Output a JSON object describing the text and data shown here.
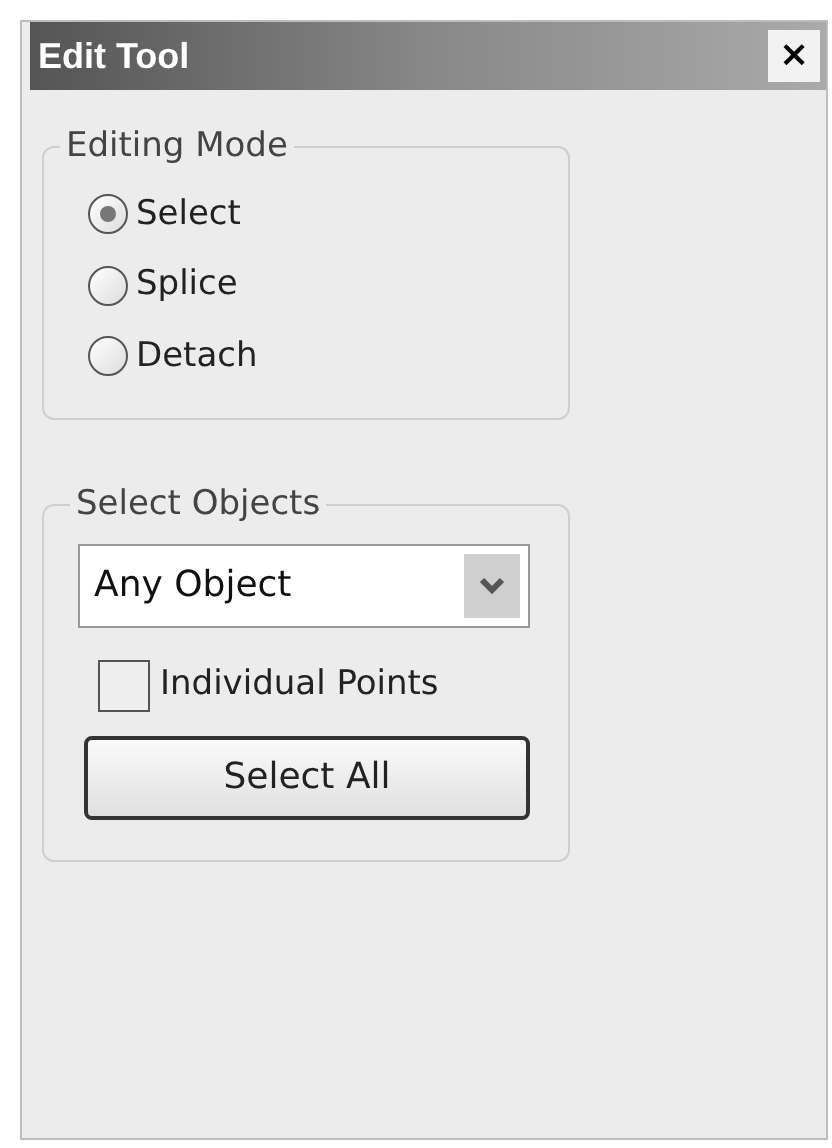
{
  "window": {
    "title": "Edit Tool",
    "close": "×"
  },
  "editing_mode": {
    "title": "Editing Mode",
    "options": [
      {
        "label": "Select",
        "selected": true
      },
      {
        "label": "Splice",
        "selected": false
      },
      {
        "label": "Detach",
        "selected": false
      }
    ]
  },
  "select_objects": {
    "title": "Select Objects",
    "dropdown": {
      "value": "Any Object"
    },
    "checkbox": {
      "label": "Individual Points",
      "checked": false
    },
    "button": "Select All"
  }
}
